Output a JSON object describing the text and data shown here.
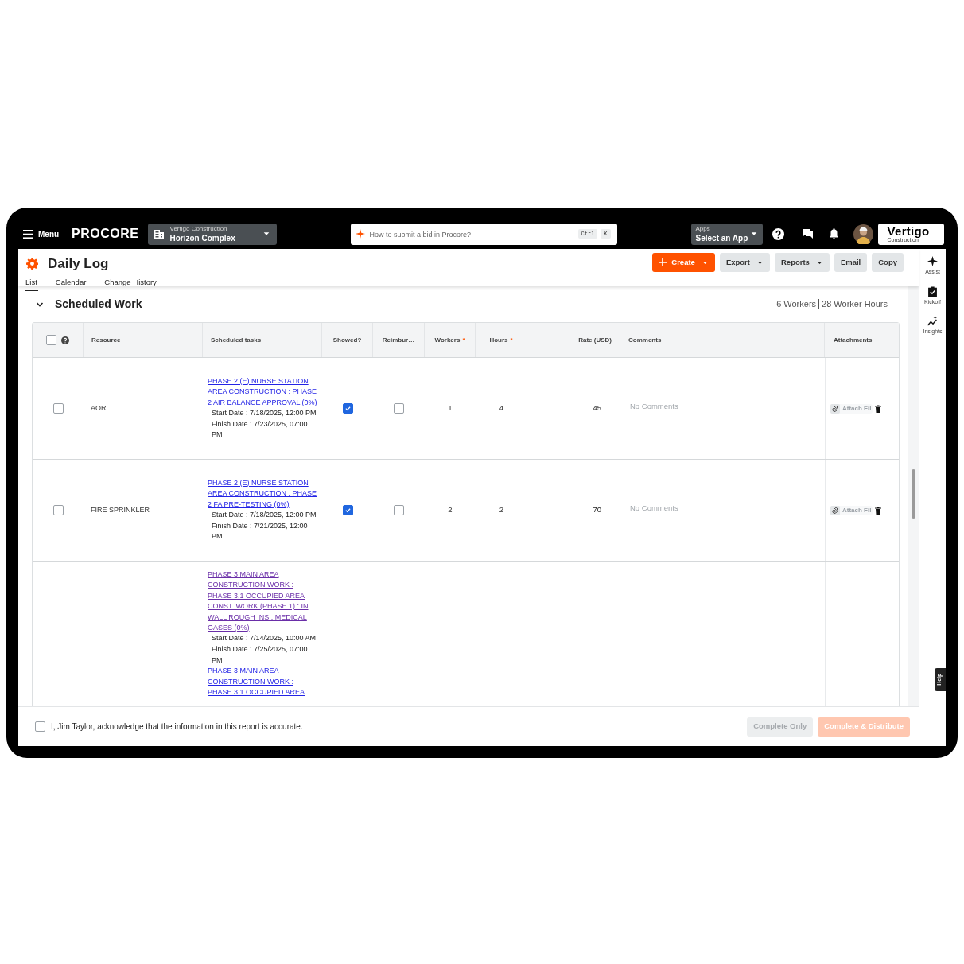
{
  "topbar": {
    "menu_label": "Menu",
    "logo": "PROCORE",
    "project": {
      "company": "Vertigo Construction",
      "name": "Horizon Complex"
    },
    "search": {
      "placeholder": "How to submit a bid in Procore?",
      "shortcut": [
        "Ctrl",
        "K"
      ]
    },
    "apps": {
      "label": "Apps",
      "value": "Select an App"
    },
    "company_logo": {
      "name": "Vertigo",
      "tagline": "Construction"
    }
  },
  "page": {
    "title": "Daily Log",
    "tabs": [
      {
        "label": "List",
        "selected": true
      },
      {
        "label": "Calendar",
        "selected": false
      },
      {
        "label": "Change History",
        "selected": false
      }
    ],
    "actions": [
      {
        "label": "Create",
        "kind": "primary",
        "dropdown": true
      },
      {
        "label": "Export",
        "kind": "secondary",
        "dropdown": true
      },
      {
        "label": "Reports",
        "kind": "secondary",
        "dropdown": true
      },
      {
        "label": "Email",
        "kind": "secondary",
        "dropdown": false
      },
      {
        "label": "Copy",
        "kind": "secondary",
        "dropdown": false
      }
    ]
  },
  "section": {
    "title": "Scheduled Work",
    "expanded": true,
    "summary": [
      "6 Workers",
      "28 Worker Hours"
    ]
  },
  "table": {
    "select_all_checked": false,
    "columns": [
      {
        "label": "Resource"
      },
      {
        "label": "Scheduled tasks"
      },
      {
        "label": "Showed?"
      },
      {
        "label": "Reimbur…"
      },
      {
        "label": "Workers",
        "required_mark": "*"
      },
      {
        "label": "Hours",
        "required_mark": "*"
      },
      {
        "label": "Rate (USD)"
      },
      {
        "label": "Comments"
      },
      {
        "label": "Attachments"
      }
    ],
    "rows": [
      {
        "selected": false,
        "resource": "AOR",
        "tasks": [
          {
            "title": "PHASE 2 (E) NURSE STATION AREA CONSTRUCTION : PHASE 2 AIR BALANCE APPROVAL (0%)",
            "visited": false,
            "start": "Start Date : 7/18/2025, 12:00 PM",
            "finish": "Finish Date : 7/23/2025, 07:00 PM"
          }
        ],
        "showed": true,
        "reimbursable": false,
        "workers": "1",
        "hours": "4",
        "rate": "45",
        "comments": {
          "placeholder": "No Comments"
        },
        "attach_label": "Attach Fil"
      },
      {
        "selected": false,
        "resource": "FIRE SPRINKLER",
        "tasks": [
          {
            "title": "PHASE 2 (E) NURSE STATION AREA CONSTRUCTION : PHASE 2 FA PRE-TESTING (0%)",
            "visited": false,
            "start": "Start Date : 7/18/2025, 12:00 PM",
            "finish": "Finish Date : 7/21/2025, 12:00 PM"
          }
        ],
        "showed": true,
        "reimbursable": false,
        "workers": "2",
        "hours": "2",
        "rate": "70",
        "comments": {
          "placeholder": "No Comments"
        },
        "attach_label": "Attach Fil"
      },
      {
        "tasks": [
          {
            "title": "PHASE 3 MAIN AREA CONSTRUCTION WORK : PHASE 3.1 OCCUPIED AREA CONST. WORK (PHASE 1) : IN WALL ROUGH INS : MEDICAL GASES (0%)",
            "visited": true,
            "start": "Start Date : 7/14/2025, 10:00 AM",
            "finish": "Finish Date : 7/25/2025, 07:00 PM"
          },
          {
            "title": "PHASE 3 MAIN AREA CONSTRUCTION WORK : PHASE 3.1 OCCUPIED AREA",
            "visited": false
          }
        ]
      }
    ]
  },
  "footer": {
    "acknowledged": false,
    "acknowledgement": "I, Jim Taylor, acknowledge that the information in this report is accurate.",
    "buttons": [
      {
        "label": "Complete Only",
        "kind": "secondary",
        "disabled": true
      },
      {
        "label": "Complete & Distribute",
        "kind": "primary",
        "disabled": true
      }
    ]
  },
  "rail": {
    "items": [
      {
        "label": "Assist",
        "kind": "assist"
      },
      {
        "label": "Kickoff",
        "kind": "kickoff"
      },
      {
        "label": "Insights",
        "kind": "insights"
      }
    ],
    "help_tab": "Help"
  }
}
